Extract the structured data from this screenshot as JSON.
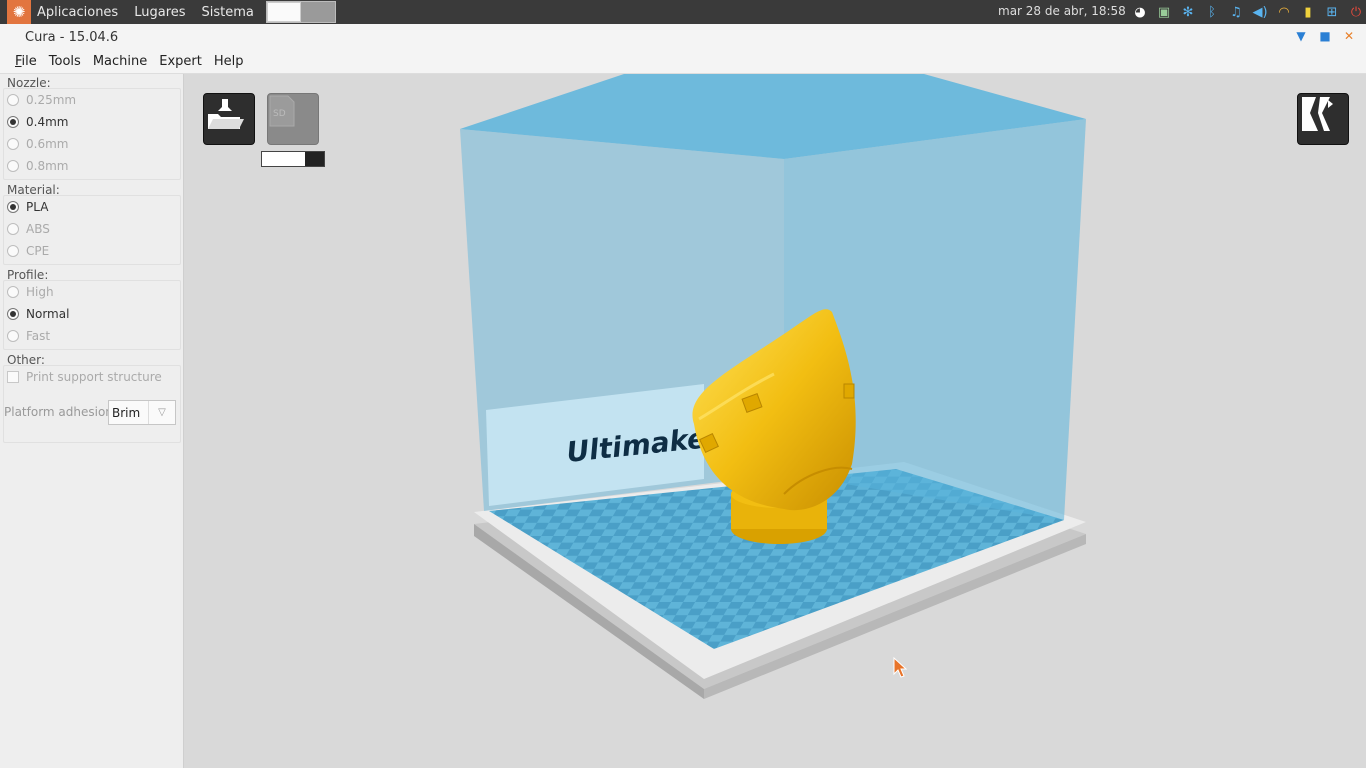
{
  "system_panel": {
    "menus": [
      "Aplicaciones",
      "Lugares",
      "Sistema"
    ],
    "clock": "mar 28 de abr, 18:58",
    "tray_icons": [
      "discord-icon",
      "network-manager-icon",
      "snowflake-icon",
      "bluetooth-icon",
      "microphone-icon",
      "volume-icon",
      "wifi-icon",
      "battery-icon",
      "layout-icon",
      "power-icon"
    ]
  },
  "window": {
    "title": "Cura - 15.04.6",
    "menubar": [
      "File",
      "Tools",
      "Machine",
      "Expert",
      "Help"
    ]
  },
  "sidebar": {
    "nozzle": {
      "label": "Nozzle:",
      "options": [
        "0.25mm",
        "0.4mm",
        "0.6mm",
        "0.8mm"
      ],
      "selected": "0.4mm"
    },
    "material": {
      "label": "Material:",
      "options": [
        "PLA",
        "ABS",
        "CPE"
      ],
      "selected": "PLA"
    },
    "profile": {
      "label": "Profile:",
      "options": [
        "High",
        "Normal",
        "Fast"
      ],
      "selected": "Normal"
    },
    "other": {
      "label": "Other:",
      "support_label": "Print support structure",
      "support_checked": false
    },
    "adhesion": {
      "label": "Platform adhesion",
      "value": "Brim"
    }
  },
  "viewport": {
    "backplate_text": "Ultimaker",
    "slice_progress": 0.7,
    "model_color": "#f2be12",
    "build_volume_color": "#5ab4dc"
  }
}
